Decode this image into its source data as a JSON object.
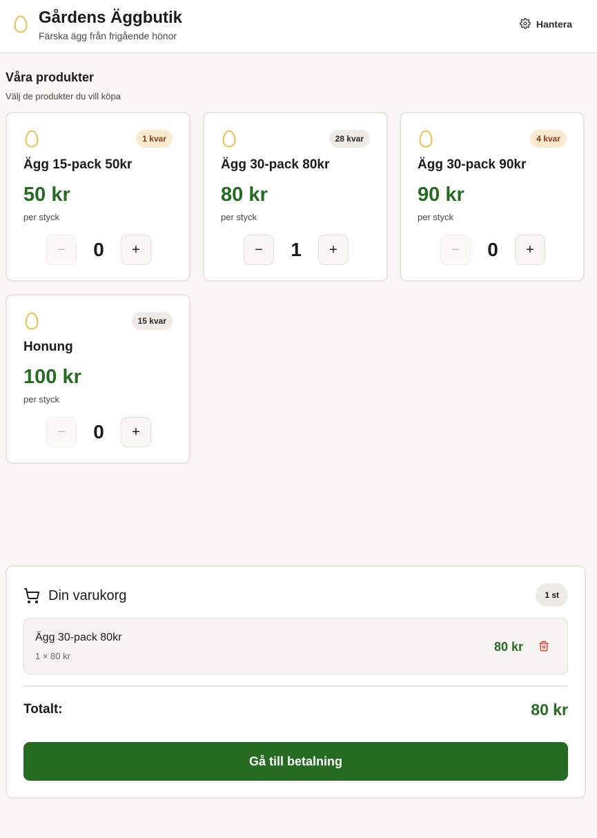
{
  "header": {
    "title": "Gårdens Äggbutik",
    "subtitle": "Färska ägg från frigående hönor",
    "manage_label": "Hantera"
  },
  "products_section": {
    "title": "Våra produkter",
    "subtitle": "Välj de produkter du vill köpa"
  },
  "products": [
    {
      "name": "Ägg 15-pack 50kr",
      "stock": "1 kvar",
      "price": "50 kr",
      "unit": "per styck",
      "qty": "0"
    },
    {
      "name": "Ägg 30-pack 80kr",
      "stock": "28 kvar",
      "price": "80 kr",
      "unit": "per styck",
      "qty": "1"
    },
    {
      "name": "Ägg 30-pack 90kr",
      "stock": "4 kvar",
      "price": "90 kr",
      "unit": "per styck",
      "qty": "0"
    },
    {
      "name": "Honung",
      "stock": "15 kvar",
      "price": "100 kr",
      "unit": "per styck",
      "qty": "0"
    }
  ],
  "cart": {
    "title": "Din varukorg",
    "count": "1 st",
    "items": [
      {
        "name": "Ägg 30-pack 80kr",
        "detail": "1 × 80 kr",
        "price": "80 kr"
      }
    ],
    "total_label": "Totalt:",
    "total_value": "80 kr",
    "checkout_label": "Gå till betalning"
  },
  "colors": {
    "accent_green": "#256b22",
    "egg_yellow": "#e8c14a",
    "low_stock_bg": "#fde8d0",
    "delete_red": "#d93025"
  }
}
